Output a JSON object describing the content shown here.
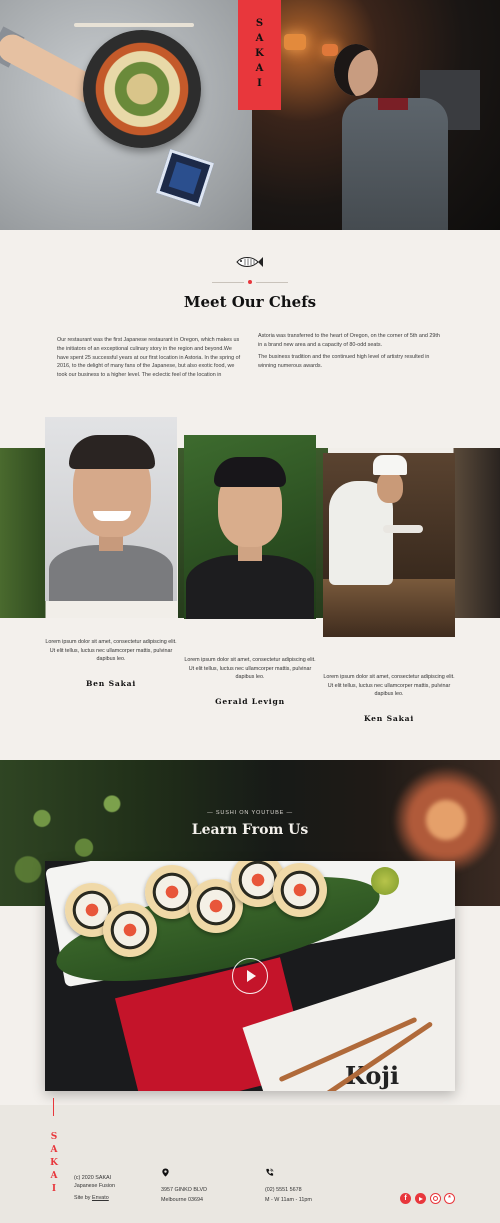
{
  "brand": {
    "name": "SAKAI"
  },
  "chefs_section": {
    "title": "Meet Our Chefs",
    "intro_left": "Our restaurant  was the first Japanese restaurant in Oregon, which makes us the initiators of an exceptional culinary story in the region and beyond.We have spent 25 successful years at our first location in Astoria. In the spring of 2016, to the delight of many fans of the Japanese, but also exotic food, we took our business to a higher level. The eclectic feel of the location in",
    "intro_right_1": "Astoria was transferred to the heart of Oregon, on the corner of 5th and 29th in a brand new area  and a capacity of 80-odd seats.",
    "intro_right_2": " The business tradition and the continued high level of artistry resulted in winning numerous awards.",
    "chefs": [
      {
        "name": "Ben Sakai",
        "description": "Lorem ipsum dolor sit amet, consectetur adipiscing elit. Ut elit tellus, luctus nec ullamcorper mattis, pulvinar dapibus leo."
      },
      {
        "name": "Gerald Levign",
        "description": "Lorem ipsum dolor sit amet, consectetur adipiscing elit. Ut elit tellus, luctus nec ullamcorper mattis, pulvinar dapibus leo."
      },
      {
        "name": "Ken Sakai",
        "description": "Lorem ipsum dolor sit amet, consectetur adipiscing elit. Ut elit tellus, luctus nec ullamcorper mattis, pulvinar dapibus leo."
      }
    ]
  },
  "video_section": {
    "kicker": "— SUSHI ON YOUTUBE —",
    "title": "Learn From Us",
    "paper_text": "Koji"
  },
  "footer": {
    "copyright": "(c) 2020 SAKAI",
    "tagline": "Japanese Fusion",
    "credit_prefix": "Site by ",
    "credit_link": "Envato",
    "address_line1": "3957 GINKO BLVD",
    "address_line2": "Melbourne 03694",
    "phone": "(02) 5551 5678",
    "hours": "M - W 11am - 11pm",
    "social": [
      "facebook-icon",
      "youtube-icon",
      "whatsapp-icon",
      "yelp-icon"
    ]
  },
  "colors": {
    "accent": "#e8373c",
    "background": "#f3f0ec"
  }
}
